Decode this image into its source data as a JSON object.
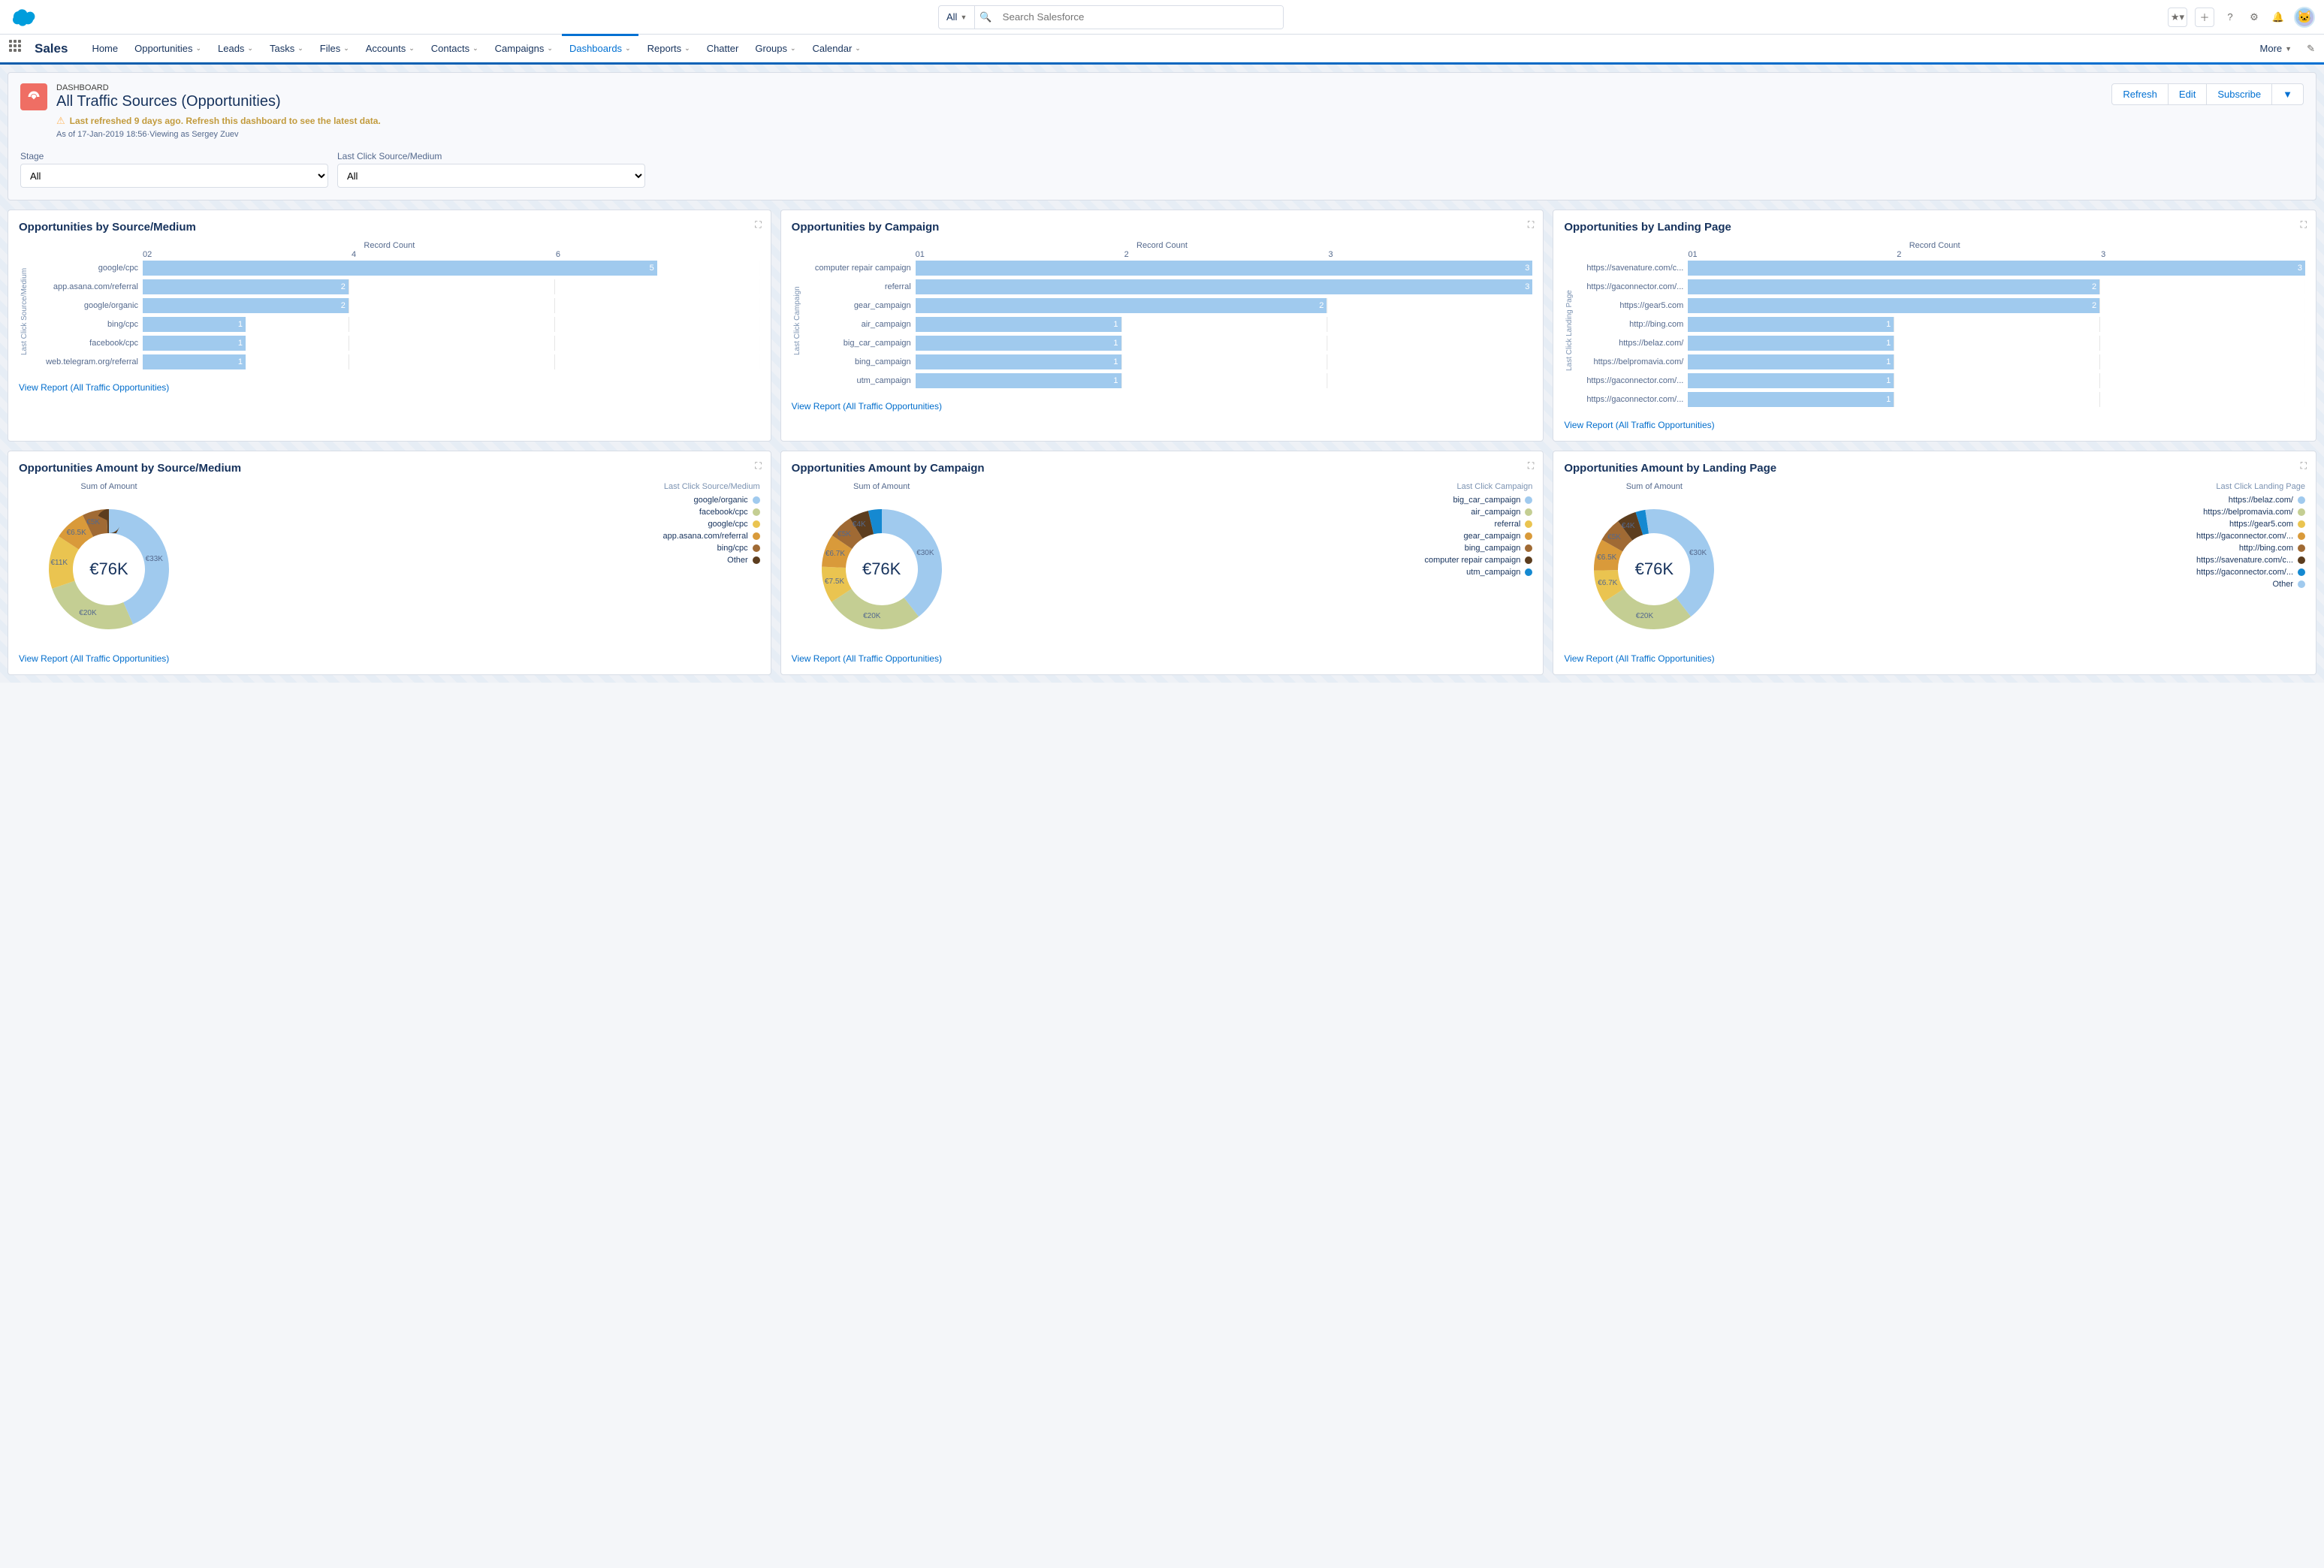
{
  "header": {
    "search_scope": "All",
    "search_placeholder": "Search Salesforce"
  },
  "nav": {
    "app_name": "Sales",
    "items": [
      "Home",
      "Opportunities",
      "Leads",
      "Tasks",
      "Files",
      "Accounts",
      "Contacts",
      "Campaigns",
      "Dashboards",
      "Reports",
      "Chatter",
      "Groups",
      "Calendar"
    ],
    "active": "Dashboards",
    "more": "More"
  },
  "page": {
    "crumb": "DASHBOARD",
    "title": "All Traffic Sources (Opportunities)",
    "warn": "Last refreshed 9 days ago. Refresh this dashboard to see the latest data.",
    "meta": "As of 17-Jan-2019 18:56·Viewing as Sergey Zuev",
    "actions": {
      "refresh": "Refresh",
      "edit": "Edit",
      "subscribe": "Subscribe"
    }
  },
  "filters": [
    {
      "label": "Stage",
      "value": "All"
    },
    {
      "label": "Last Click Source/Medium",
      "value": "All"
    }
  ],
  "colors": [
    "#a0caee",
    "#c4ce93",
    "#eac450",
    "#d99a3a",
    "#a06a34",
    "#5c3d1e",
    "#1589d1"
  ],
  "chart_data": [
    {
      "id": "bar1",
      "type": "bar",
      "title": "Opportunities by Source/Medium",
      "xlabel": "Record Count",
      "ylabel": "Last Click Source/Medium",
      "xlim": [
        0,
        6
      ],
      "ticks": [
        0,
        2,
        4,
        6
      ],
      "categories": [
        "google/cpc",
        "app.asana.com/referral",
        "google/organic",
        "bing/cpc",
        "facebook/cpc",
        "web.telegram.org/referral"
      ],
      "values": [
        5,
        2,
        2,
        1,
        1,
        1
      ],
      "view_link": "View Report (All Traffic Opportunities)"
    },
    {
      "id": "bar2",
      "type": "bar",
      "title": "Opportunities by Campaign",
      "xlabel": "Record Count",
      "ylabel": "Last Click Campaign",
      "xlim": [
        0,
        3
      ],
      "ticks": [
        0,
        1,
        2,
        3
      ],
      "categories": [
        "computer repair campaign",
        "referral",
        "gear_campaign",
        "air_campaign",
        "big_car_campaign",
        "bing_campaign",
        "utm_campaign"
      ],
      "values": [
        3,
        3,
        2,
        1,
        1,
        1,
        1
      ],
      "view_link": "View Report (All Traffic Opportunities)"
    },
    {
      "id": "bar3",
      "type": "bar",
      "title": "Opportunities by Landing Page",
      "xlabel": "Record Count",
      "ylabel": "Last Click Landing Page",
      "xlim": [
        0,
        3
      ],
      "ticks": [
        0,
        1,
        2,
        3
      ],
      "categories": [
        "https://savenature.com/c...",
        "https://gaconnector.com/...",
        "https://gear5.com",
        "http://bing.com",
        "https://belaz.com/",
        "https://belpromavia.com/",
        "https://gaconnector.com/...",
        "https://gaconnector.com/..."
      ],
      "values": [
        3,
        2,
        2,
        1,
        1,
        1,
        1,
        1
      ],
      "view_link": "View Report (All Traffic Opportunities)"
    },
    {
      "id": "donut1",
      "type": "donut",
      "title": "Opportunities Amount by Source/Medium",
      "center": "€76K",
      "sum_label": "Sum of Amount",
      "legend_title": "Last Click Source/Medium",
      "series": [
        {
          "name": "google/organic",
          "value": 33,
          "label": "€33K"
        },
        {
          "name": "facebook/cpc",
          "value": 20,
          "label": "€20K"
        },
        {
          "name": "google/cpc",
          "value": 11,
          "label": "€11K"
        },
        {
          "name": "app.asana.com/referral",
          "value": 6.5,
          "label": "€6.5K"
        },
        {
          "name": "bing/cpc",
          "value": 5,
          "label": "€5K"
        },
        {
          "name": "Other",
          "value": 0.5,
          "label": ""
        }
      ],
      "view_link": "View Report (All Traffic Opportunities)"
    },
    {
      "id": "donut2",
      "type": "donut",
      "title": "Opportunities Amount by Campaign",
      "center": "€76K",
      "sum_label": "Sum of Amount",
      "legend_title": "Last Click Campaign",
      "series": [
        {
          "name": "big_car_campaign",
          "value": 30,
          "label": "€30K"
        },
        {
          "name": "air_campaign",
          "value": 20,
          "label": "€20K"
        },
        {
          "name": "referral",
          "value": 7.5,
          "label": "€7.5K"
        },
        {
          "name": "gear_campaign",
          "value": 6.7,
          "label": "€6.7K"
        },
        {
          "name": "bing_campaign",
          "value": 5,
          "label": "€5K"
        },
        {
          "name": "computer repair campaign",
          "value": 4,
          "label": "€4K"
        },
        {
          "name": "utm_campaign",
          "value": 2.8,
          "label": ""
        }
      ],
      "view_link": "View Report (All Traffic Opportunities)"
    },
    {
      "id": "donut3",
      "type": "donut",
      "title": "Opportunities Amount by Landing Page",
      "center": "€76K",
      "sum_label": "Sum of Amount",
      "legend_title": "Last Click Landing Page",
      "series": [
        {
          "name": "https://belaz.com/",
          "value": 30,
          "label": "€30K"
        },
        {
          "name": "https://belpromavia.com/",
          "value": 20,
          "label": "€20K"
        },
        {
          "name": "https://gear5.com",
          "value": 6.7,
          "label": "€6.7K"
        },
        {
          "name": "https://gaconnector.com/...",
          "value": 6.5,
          "label": "€6.5K"
        },
        {
          "name": "http://bing.com",
          "value": 5,
          "label": "€5K"
        },
        {
          "name": "https://savenature.com/c...",
          "value": 4,
          "label": "€4K"
        },
        {
          "name": "https://gaconnector.com/...",
          "value": 2,
          "label": ""
        },
        {
          "name": "Other",
          "value": 1.8,
          "label": ""
        }
      ],
      "view_link": "View Report (All Traffic Opportunities)"
    }
  ]
}
